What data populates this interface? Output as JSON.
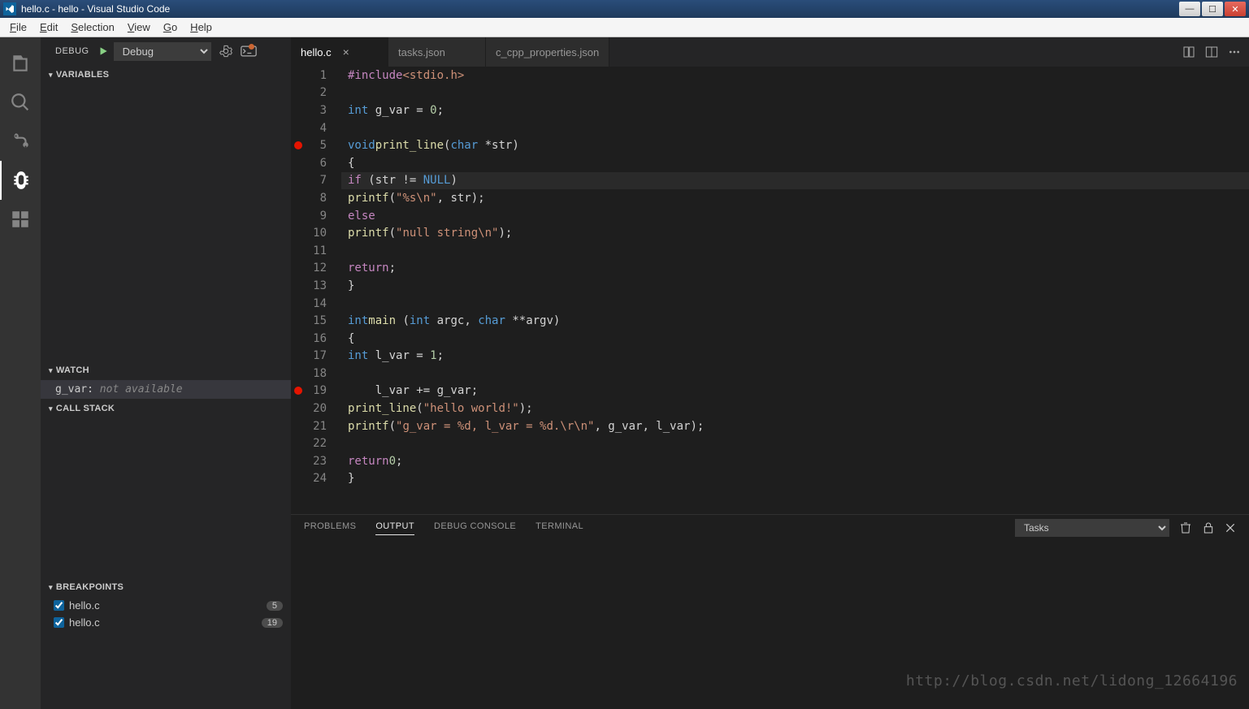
{
  "window": {
    "title": "hello.c - hello - Visual Studio Code"
  },
  "winbtns": {
    "min": "—",
    "max": "☐",
    "close": "✕"
  },
  "menubar": [
    {
      "label": "File",
      "u": "F",
      "rest": "ile"
    },
    {
      "label": "Edit",
      "u": "E",
      "rest": "dit"
    },
    {
      "label": "Selection",
      "u": "S",
      "rest": "election"
    },
    {
      "label": "View",
      "u": "V",
      "rest": "iew"
    },
    {
      "label": "Go",
      "u": "G",
      "rest": "o"
    },
    {
      "label": "Help",
      "u": "H",
      "rest": "elp"
    }
  ],
  "debug": {
    "label": "DEBUG",
    "config": "Debug"
  },
  "sections": {
    "variables": "VARIABLES",
    "watch": "WATCH",
    "callstack": "CALL STACK",
    "breakpoints": "BREAKPOINTS"
  },
  "watch": {
    "expr": "g_var:",
    "value": "not available"
  },
  "breakpoints": [
    {
      "file": "hello.c",
      "line": "5",
      "checked": true
    },
    {
      "file": "hello.c",
      "line": "19",
      "checked": true
    }
  ],
  "tabs": [
    {
      "label": "hello.c",
      "active": true
    },
    {
      "label": "tasks.json",
      "active": false
    },
    {
      "label": "c_cpp_properties.json",
      "active": false
    }
  ],
  "code": {
    "current_line": 7,
    "breakpoint_lines": [
      5,
      19
    ],
    "lines": [
      {
        "n": 1,
        "html": "<span class='tok-inc'>#include</span> <span class='tok-str'>&lt;stdio.h&gt;</span>"
      },
      {
        "n": 2,
        "html": ""
      },
      {
        "n": 3,
        "html": "<span class='tok-type'>int</span> g_var = <span class='tok-num'>0</span>;"
      },
      {
        "n": 4,
        "html": ""
      },
      {
        "n": 5,
        "html": "<span class='tok-type'>void</span> <span class='tok-fn'>print_line</span>(<span class='tok-type'>char</span> *str)"
      },
      {
        "n": 6,
        "html": "{"
      },
      {
        "n": 7,
        "html": "    <span class='tok-return'>if</span> (str != <span class='tok-const'>NULL</span>)"
      },
      {
        "n": 8,
        "html": "        <span class='tok-fn'>printf</span>(<span class='tok-str'>\"%s\\n\"</span>, str);"
      },
      {
        "n": 9,
        "html": "    <span class='tok-return'>else</span>"
      },
      {
        "n": 10,
        "html": "        <span class='tok-fn'>printf</span>(<span class='tok-str'>\"null string\\n\"</span>);"
      },
      {
        "n": 11,
        "html": ""
      },
      {
        "n": 12,
        "html": "    <span class='tok-return'>return</span>;"
      },
      {
        "n": 13,
        "html": "}"
      },
      {
        "n": 14,
        "html": ""
      },
      {
        "n": 15,
        "html": "<span class='tok-type'>int</span> <span class='tok-fn'>main</span> (<span class='tok-type'>int</span> argc, <span class='tok-type'>char</span> **argv)"
      },
      {
        "n": 16,
        "html": "{"
      },
      {
        "n": 17,
        "html": "    <span class='tok-type'>int</span> l_var = <span class='tok-num'>1</span>;"
      },
      {
        "n": 18,
        "html": ""
      },
      {
        "n": 19,
        "html": "    l_var += g_var;"
      },
      {
        "n": 20,
        "html": "    <span class='tok-fn'>print_line</span>(<span class='tok-str'>\"hello world!\"</span>);"
      },
      {
        "n": 21,
        "html": "    <span class='tok-fn'>printf</span>(<span class='tok-str'>\"g_var = %d, l_var = %d.\\r\\n\"</span>, g_var, l_var);"
      },
      {
        "n": 22,
        "html": ""
      },
      {
        "n": 23,
        "html": "    <span class='tok-return'>return</span> <span class='tok-num'>0</span>;"
      },
      {
        "n": 24,
        "html": "}"
      }
    ]
  },
  "panel": {
    "tabs": [
      "PROBLEMS",
      "OUTPUT",
      "DEBUG CONSOLE",
      "TERMINAL"
    ],
    "active": "OUTPUT",
    "select": "Tasks"
  },
  "watermark": "http://blog.csdn.net/lidong_12664196"
}
